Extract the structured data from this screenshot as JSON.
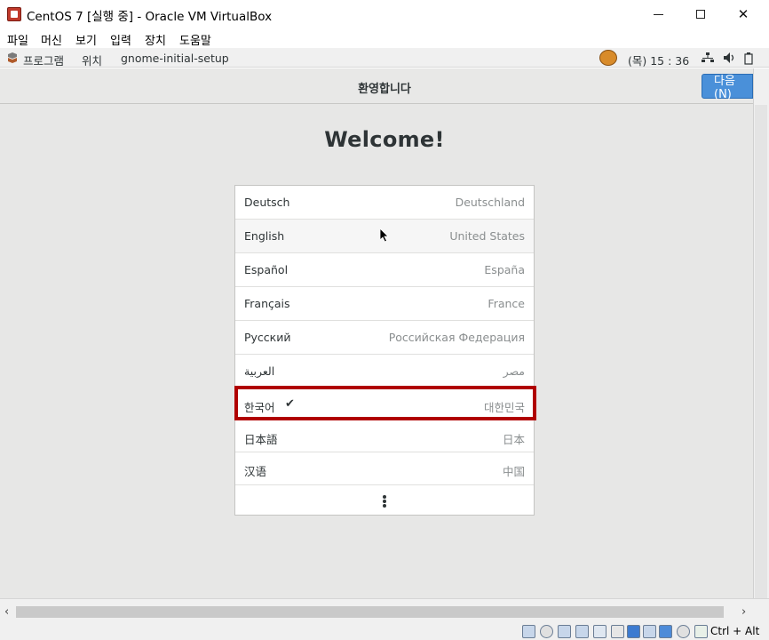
{
  "window": {
    "title": "CentOS 7 [실행 중] - Oracle VM VirtualBox",
    "controls": {
      "minimize": "minimize",
      "maximize": "maximize",
      "close": "✕"
    }
  },
  "menubar": {
    "items": [
      "파일",
      "머신",
      "보기",
      "입력",
      "장치",
      "도움말"
    ]
  },
  "gnome_panel": {
    "applications": "프로그램",
    "places": "위치",
    "current_app": "gnome-initial-setup",
    "clock": "(목) 15 : 36"
  },
  "header": {
    "title": "환영합니다",
    "next_button": "다음(N)"
  },
  "main": {
    "heading": "Welcome!",
    "languages": [
      {
        "name": "Deutsch",
        "region": "Deutschland",
        "selected": false
      },
      {
        "name": "English",
        "region": "United States",
        "selected": false
      },
      {
        "name": "Español",
        "region": "España",
        "selected": false
      },
      {
        "name": "Français",
        "region": "France",
        "selected": false
      },
      {
        "name": "Русский",
        "region": "Российская Федерация",
        "selected": false
      },
      {
        "name": "العربية",
        "region": "مصر",
        "selected": false
      },
      {
        "name": "한국어",
        "region": "대한민국",
        "selected": true
      },
      {
        "name": "日本語",
        "region": "日本",
        "selected": false
      },
      {
        "name": "汉语",
        "region": "中国",
        "selected": false
      }
    ],
    "check_mark": "✔",
    "more_icon": "more-options-icon"
  },
  "statusbar": {
    "host_key": "Ctrl + Alt"
  },
  "colors": {
    "accent_button": "#4a90d9",
    "highlight_border": "#b00000",
    "panel_bg": "#e7e7e6"
  }
}
